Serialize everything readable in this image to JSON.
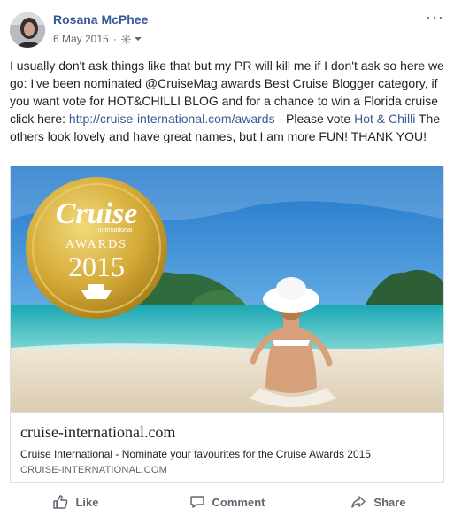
{
  "post": {
    "author": "Rosana McPhee",
    "date": "6 May 2015",
    "separator": "·",
    "text_pre": "I usually don't ask things like that but my PR will kill me if I don't ask so here we go: I've been nominated @CruiseMag awards Best Cruise Blogger category, if you want vote for HOT&CHILLI BLOG and for a chance to win a Florida cruise click here: ",
    "link_url": "http://cruise-international.com/awards",
    "text_mid": " - Please vote ",
    "link_page": "Hot & Chilli",
    "text_post": " The others look lovely and have great names, but I am more FUN! THANK YOU!"
  },
  "badge": {
    "brand": "Cruise",
    "sub": "International",
    "awards": "AWARDS",
    "year": "2015"
  },
  "card": {
    "title": "cruise-international.com",
    "description": "Cruise International - Nominate your favourites for the Cruise Awards 2015",
    "domain": "CRUISE-INTERNATIONAL.COM"
  },
  "actions": {
    "like": "Like",
    "comment": "Comment",
    "share": "Share"
  },
  "colors": {
    "link": "#385898",
    "meta": "#606770",
    "gold": "#c9a227"
  }
}
